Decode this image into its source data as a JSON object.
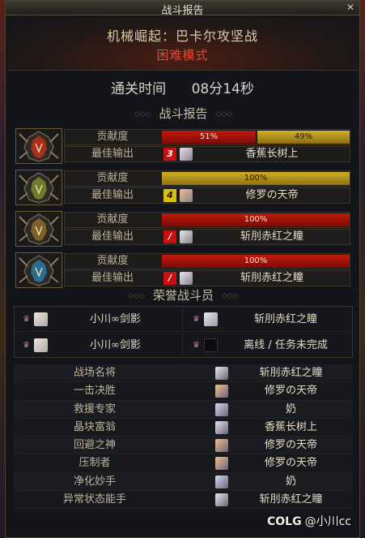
{
  "window": {
    "title": "战斗报告",
    "close_label": "✕"
  },
  "header": {
    "dungeon_name": "机械崛起：巴卡尔攻坚战",
    "difficulty": "困难模式"
  },
  "clear_time": {
    "label": "通关时间",
    "value": "08分14秒"
  },
  "report": {
    "heading": "战斗报告",
    "contribution_label": "贡献度",
    "best_output_label": "最佳输出",
    "players": [
      {
        "shares": [
          {
            "value": "51%",
            "fraction": 0.51,
            "color": "red"
          },
          {
            "value": "49%",
            "fraction": 0.49,
            "color": "gold"
          }
        ],
        "rank": "3",
        "rank_color": "#c81010",
        "best_name": "香蕉长树上",
        "accent": "#c0301c"
      },
      {
        "shares": [
          {
            "value": "100%",
            "fraction": 1.0,
            "color": "gold"
          }
        ],
        "rank": "4",
        "rank_color": "#d8c010",
        "best_name": "修罗の天帝",
        "accent": "#7a8a2a"
      },
      {
        "shares": [
          {
            "value": "100%",
            "fraction": 1.0,
            "color": "red"
          }
        ],
        "rank": "/",
        "rank_color": "#c81010",
        "best_name": "斩刖赤红之瞳",
        "accent": "#8a6a2a"
      },
      {
        "shares": [
          {
            "value": "100%",
            "fraction": 1.0,
            "color": "red"
          }
        ],
        "rank": "/",
        "rank_color": "#c81010",
        "best_name": "斩刖赤红之瞳",
        "accent": "#2a7aa8"
      }
    ]
  },
  "honor": {
    "heading": "荣誉战斗员",
    "members": [
      "小川∞剑影",
      "斩刖赤红之瞳",
      "小川∞剑影",
      "离线 / 任务未完成"
    ]
  },
  "awards": [
    {
      "title": "战场名将",
      "name": "斩刖赤红之瞳"
    },
    {
      "title": "一击决胜",
      "name": "修罗の天帝"
    },
    {
      "title": "救援专家",
      "name": "奶"
    },
    {
      "title": "晶块富翁",
      "name": "香蕉长树上"
    },
    {
      "title": "回避之神",
      "name": "修罗の天帝"
    },
    {
      "title": "压制者",
      "name": "修罗の天帝"
    },
    {
      "title": "净化妙手",
      "name": "奶"
    },
    {
      "title": "异常状态能手",
      "name": "斩刖赤红之瞳"
    }
  ],
  "watermark": {
    "logo": "COLG",
    "text": "@小川cc"
  }
}
